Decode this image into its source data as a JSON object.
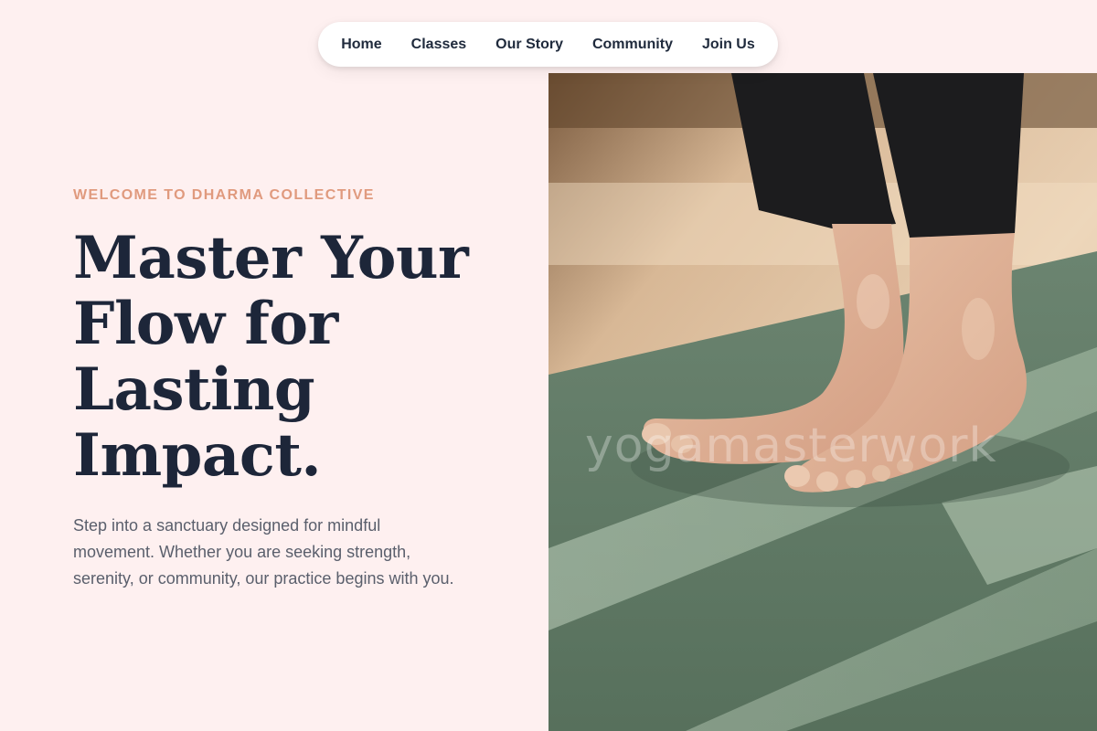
{
  "nav": {
    "items": [
      {
        "label": "Home"
      },
      {
        "label": "Classes"
      },
      {
        "label": "Our Story"
      },
      {
        "label": "Community"
      },
      {
        "label": "Join Us"
      }
    ]
  },
  "hero": {
    "eyebrow": "WELCOME TO DHARMA COLLECTIVE",
    "headline_lines": [
      "Master Your",
      "Flow for",
      "Lasting",
      "Impact."
    ],
    "description": "Step into a sanctuary designed for mindful movement. Whether you are seeking strength, serenity, or community, our practice begins with you."
  },
  "image": {
    "watermark": "yogamasterwork"
  },
  "colors": {
    "background": "#fef0f0",
    "accent": "#e09a7e",
    "heading": "#1d2639",
    "body_text": "#5a5f6c",
    "mat_green": "#5f7a63"
  }
}
